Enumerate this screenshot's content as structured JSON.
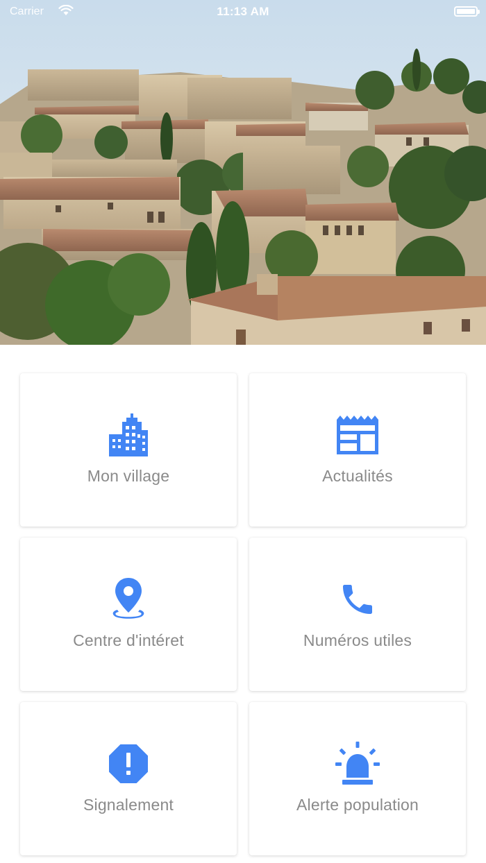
{
  "status_bar": {
    "carrier": "Carrier",
    "time": "11:13 AM"
  },
  "hero": {
    "image": "provence-village-photo"
  },
  "accent_color": "#4285f4",
  "tiles": [
    {
      "label": "Mon village",
      "icon": "city-buildings-icon"
    },
    {
      "label": "Actualités",
      "icon": "newspaper-icon"
    },
    {
      "label": "Centre d'intéret",
      "icon": "map-pin-icon"
    },
    {
      "label": "Numéros utiles",
      "icon": "phone-icon"
    },
    {
      "label": "Signalement",
      "icon": "report-octagon-icon"
    },
    {
      "label": "Alerte population",
      "icon": "siren-icon"
    }
  ]
}
